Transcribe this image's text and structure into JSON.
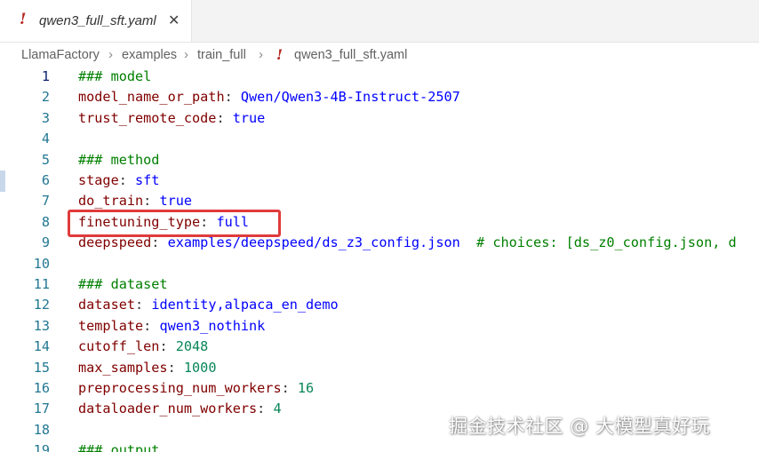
{
  "tab": {
    "icon": "!",
    "title": "qwen3_full_sft.yaml",
    "close_symbol": "✕"
  },
  "breadcrumb": {
    "items": [
      "LlamaFactory",
      "examples",
      "train_full"
    ],
    "separator": "›",
    "file_icon": "!",
    "file": "qwen3_full_sft.yaml"
  },
  "editor": {
    "active_line": 1,
    "lines": [
      {
        "n": "1",
        "tokens": [
          {
            "t": "### model",
            "c": "comment"
          }
        ]
      },
      {
        "n": "2",
        "tokens": [
          {
            "t": "model_name_or_path",
            "c": "key"
          },
          {
            "t": ": ",
            "c": "punct"
          },
          {
            "t": "Qwen/Qwen3-4B-Instruct-2507",
            "c": "str"
          }
        ]
      },
      {
        "n": "3",
        "tokens": [
          {
            "t": "trust_remote_code",
            "c": "key"
          },
          {
            "t": ": ",
            "c": "punct"
          },
          {
            "t": "true",
            "c": "bool"
          }
        ]
      },
      {
        "n": "4",
        "tokens": []
      },
      {
        "n": "5",
        "tokens": [
          {
            "t": "### method",
            "c": "comment"
          }
        ]
      },
      {
        "n": "6",
        "tokens": [
          {
            "t": "stage",
            "c": "key"
          },
          {
            "t": ": ",
            "c": "punct"
          },
          {
            "t": "sft",
            "c": "str"
          }
        ]
      },
      {
        "n": "7",
        "tokens": [
          {
            "t": "do_train",
            "c": "key"
          },
          {
            "t": ": ",
            "c": "punct"
          },
          {
            "t": "true",
            "c": "bool"
          }
        ]
      },
      {
        "n": "8",
        "tokens": [
          {
            "t": "finetuning_type",
            "c": "key"
          },
          {
            "t": ": ",
            "c": "punct"
          },
          {
            "t": "full",
            "c": "str"
          }
        ]
      },
      {
        "n": "9",
        "tokens": [
          {
            "t": "deepspeed",
            "c": "key"
          },
          {
            "t": ": ",
            "c": "punct"
          },
          {
            "t": "examples/deepspeed/ds_z3_config.json",
            "c": "str"
          },
          {
            "t": "  # choices: [ds_z0_config.json, d",
            "c": "inline-comment"
          }
        ]
      },
      {
        "n": "10",
        "tokens": []
      },
      {
        "n": "11",
        "tokens": [
          {
            "t": "### dataset",
            "c": "comment"
          }
        ]
      },
      {
        "n": "12",
        "tokens": [
          {
            "t": "dataset",
            "c": "key"
          },
          {
            "t": ": ",
            "c": "punct"
          },
          {
            "t": "identity,alpaca_en_demo",
            "c": "str"
          }
        ]
      },
      {
        "n": "13",
        "tokens": [
          {
            "t": "template",
            "c": "key"
          },
          {
            "t": ": ",
            "c": "punct"
          },
          {
            "t": "qwen3_nothink",
            "c": "str"
          }
        ]
      },
      {
        "n": "14",
        "tokens": [
          {
            "t": "cutoff_len",
            "c": "key"
          },
          {
            "t": ": ",
            "c": "punct"
          },
          {
            "t": "2048",
            "c": "num"
          }
        ]
      },
      {
        "n": "15",
        "tokens": [
          {
            "t": "max_samples",
            "c": "key"
          },
          {
            "t": ": ",
            "c": "punct"
          },
          {
            "t": "1000",
            "c": "num"
          }
        ]
      },
      {
        "n": "16",
        "tokens": [
          {
            "t": "preprocessing_num_workers",
            "c": "key"
          },
          {
            "t": ": ",
            "c": "punct"
          },
          {
            "t": "16",
            "c": "num"
          }
        ]
      },
      {
        "n": "17",
        "tokens": [
          {
            "t": "dataloader_num_workers",
            "c": "key"
          },
          {
            "t": ": ",
            "c": "punct"
          },
          {
            "t": "4",
            "c": "num"
          }
        ]
      },
      {
        "n": "18",
        "tokens": []
      },
      {
        "n": "19",
        "tokens": [
          {
            "t": "### output",
            "c": "comment"
          }
        ]
      }
    ]
  },
  "watermark": "掘金技术社区 @ 大模型真好玩",
  "colors": {
    "highlight_border": "#e03b3b",
    "comment": "#008000",
    "key": "#800000",
    "string": "#0000ff",
    "number": "#098658",
    "line_number": "#237893"
  }
}
